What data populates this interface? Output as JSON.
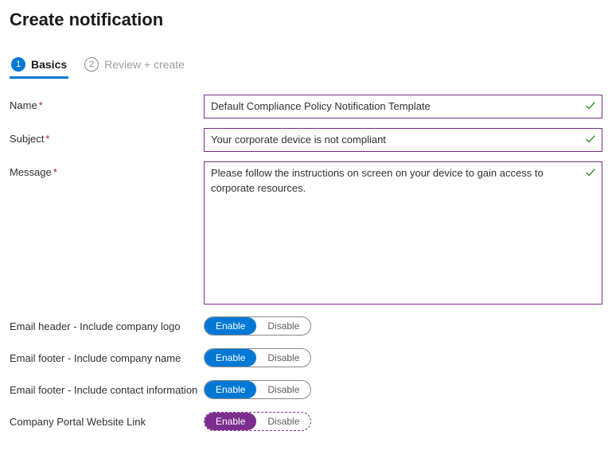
{
  "title": "Create notification",
  "tabs": {
    "basics": {
      "num": "1",
      "label": "Basics"
    },
    "review": {
      "num": "2",
      "label": "Review + create"
    }
  },
  "fields": {
    "name": {
      "label": "Name",
      "value": "Default Compliance Policy Notification Template"
    },
    "subject": {
      "label": "Subject",
      "value": "Your corporate device is not compliant"
    },
    "message": {
      "label": "Message",
      "value": "Please follow the instructions on screen on your device to gain access to corporate resources."
    }
  },
  "toggles": {
    "header_logo": {
      "label": "Email header - Include company logo",
      "on": "Enable",
      "off": "Disable"
    },
    "footer_name": {
      "label": "Email footer - Include company name",
      "on": "Enable",
      "off": "Disable"
    },
    "footer_contact": {
      "label": "Email footer - Include contact information",
      "on": "Enable",
      "off": "Disable"
    },
    "portal_link": {
      "label": "Company Portal Website Link",
      "on": "Enable",
      "off": "Disable"
    }
  }
}
